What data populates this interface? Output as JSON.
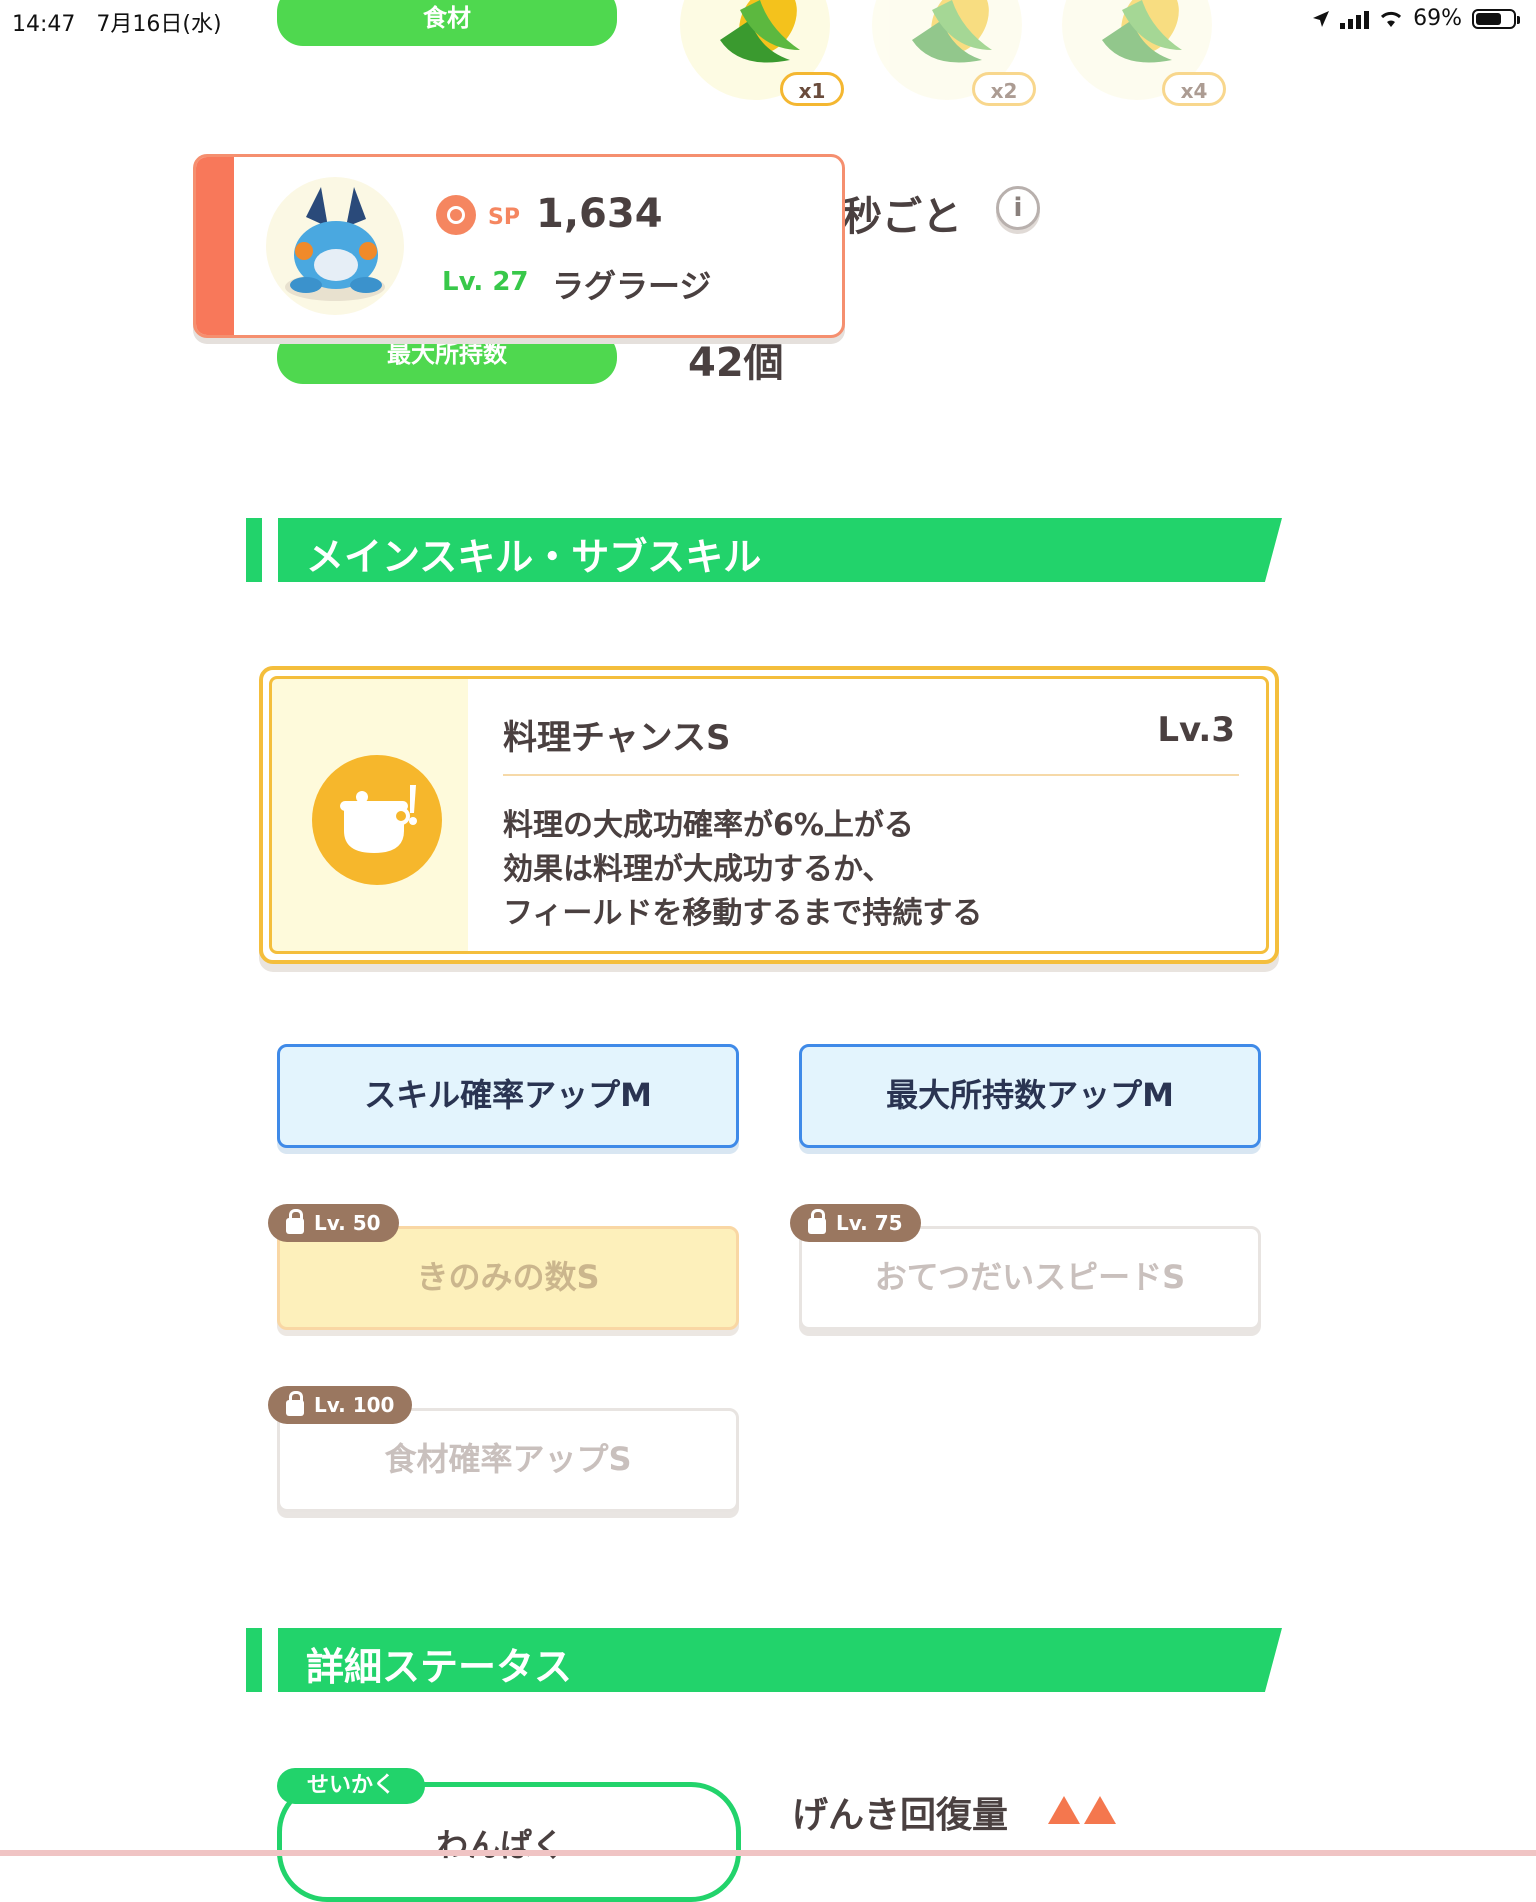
{
  "status_bar": {
    "time": "14:47",
    "date": "7月16日(水)",
    "battery_percent": "69%",
    "battery_level": 0.69
  },
  "top": {
    "ingredient_label": "食材",
    "corn_badges": [
      "x1",
      "x2",
      "x4"
    ],
    "per_seconds_text": "秒ごと",
    "max_hold_label": "最大所持数",
    "max_hold_value": "42個"
  },
  "pokemon_card": {
    "sp_label": "SP",
    "sp_value": "1,634",
    "level": "Lv. 27",
    "name": "ラグラージ"
  },
  "sections": {
    "skills_title": "メインスキル・サブスキル",
    "details_title": "詳細ステータス"
  },
  "main_skill": {
    "name": "料理チャンスS",
    "level": "Lv.3",
    "description_lines": [
      "料理の大成功確率が6%上がる",
      "効果は料理が大成功するか、",
      "フィールドを移動するまで持続する"
    ]
  },
  "sub_skills": [
    {
      "label": "スキル確率アップM",
      "lock": ""
    },
    {
      "label": "最大所持数アップM",
      "lock": ""
    },
    {
      "label": "きのみの数S",
      "lock": "Lv. 50"
    },
    {
      "label": "おてつだいスピードS",
      "lock": "Lv. 75"
    },
    {
      "label": "食材確率アップS",
      "lock": "Lv. 100"
    }
  ],
  "details": {
    "nature_tag": "せいかく",
    "nature_value": "わんぱく",
    "stat_label": "げんき回復量",
    "stat_arrows": 2
  },
  "colors": {
    "accent_green": "#22d36b",
    "card_coral": "#f8785a",
    "skill_gold": "#f4be3c",
    "subskill_blue": "#3f8ae8"
  }
}
